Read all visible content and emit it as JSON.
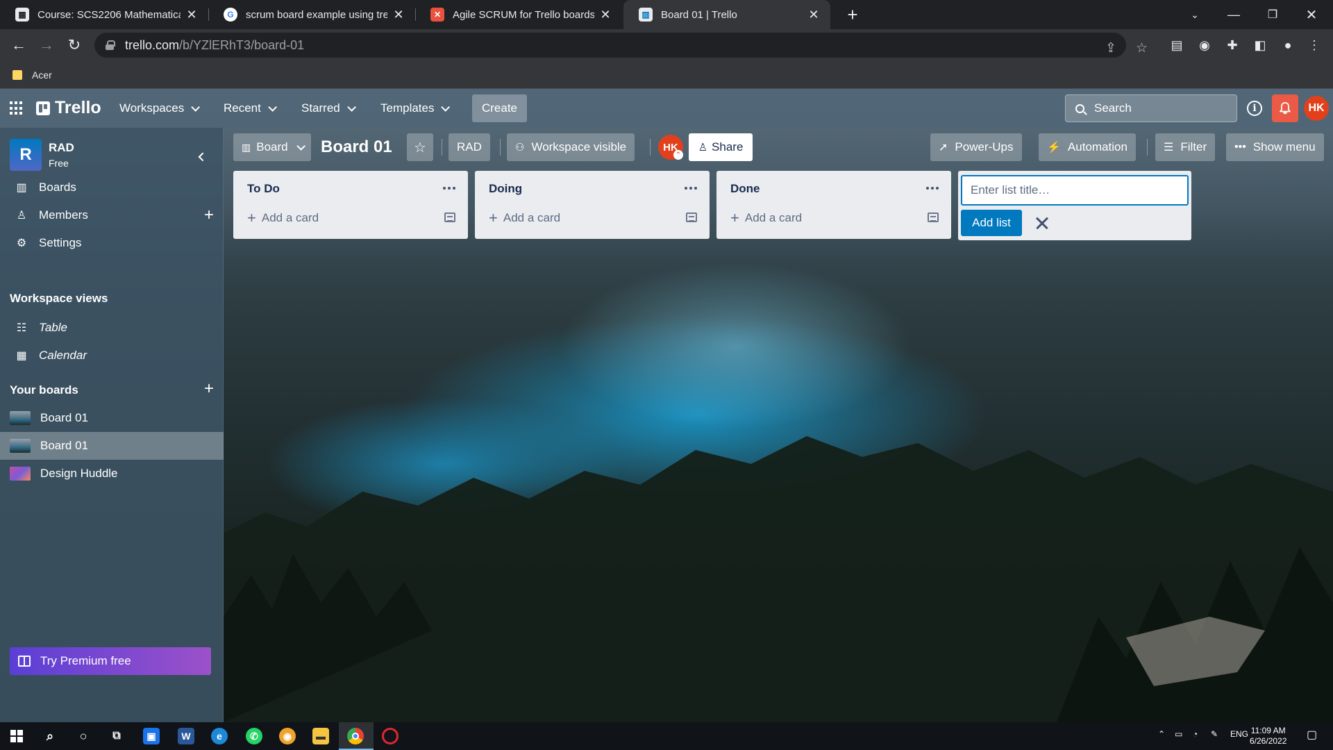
{
  "browser": {
    "tabs": [
      {
        "title": "Course: SCS2206 Mathematical Met",
        "favicon": "moodle-icon",
        "active": false
      },
      {
        "title": "scrum board example using trello -",
        "favicon": "google-icon",
        "active": false
      },
      {
        "title": "Agile SCRUM for Trello boards",
        "favicon": "scrum-addon-icon",
        "active": false
      },
      {
        "title": "Board 01 | Trello",
        "favicon": "trello-icon",
        "active": true
      }
    ],
    "url_host": "trello.com",
    "url_path": "/b/YZlERhT3/board-01",
    "bookmark": "Acer"
  },
  "trello": {
    "logo": "Trello",
    "nav": {
      "workspaces": "Workspaces",
      "recent": "Recent",
      "starred": "Starred",
      "templates": "Templates",
      "create": "Create",
      "search_placeholder": "Search",
      "avatar": "HK"
    },
    "sidebar": {
      "workspace_initial": "R",
      "workspace_name": "RAD",
      "plan": "Free",
      "items": [
        {
          "label": "Boards",
          "icon": "boards-icon"
        },
        {
          "label": "Members",
          "icon": "member-icon"
        },
        {
          "label": "Settings",
          "icon": "gear-icon"
        }
      ],
      "views_heading": "Workspace views",
      "views": [
        {
          "label": "Table",
          "icon": "table-icon"
        },
        {
          "label": "Calendar",
          "icon": "calendar-icon"
        }
      ],
      "boards_heading": "Your boards",
      "boards": [
        {
          "label": "Board 01",
          "selected": false
        },
        {
          "label": "Board 01",
          "selected": true
        },
        {
          "label": "Design Huddle",
          "selected": false
        }
      ],
      "premium": "Try Premium free"
    },
    "board_header": {
      "view": "Board",
      "title": "Board 01",
      "workspace": "RAD",
      "visibility": "Workspace visible",
      "member": "HK",
      "share": "Share",
      "powerups": "Power-Ups",
      "automation": "Automation",
      "filter": "Filter",
      "show_menu": "Show menu"
    },
    "lists": [
      {
        "title": "To Do",
        "add_card": "Add a card"
      },
      {
        "title": "Doing",
        "add_card": "Add a card"
      },
      {
        "title": "Done",
        "add_card": "Add a card"
      }
    ],
    "new_list": {
      "placeholder": "Enter list title…",
      "add": "Add list"
    }
  },
  "taskbar": {
    "lang": "ENG",
    "time": "11:09 AM",
    "date": "6/26/2022"
  },
  "colors": {
    "accent": "#0079bf",
    "avatar": "#e2401c",
    "notification": "#eb5a46"
  }
}
